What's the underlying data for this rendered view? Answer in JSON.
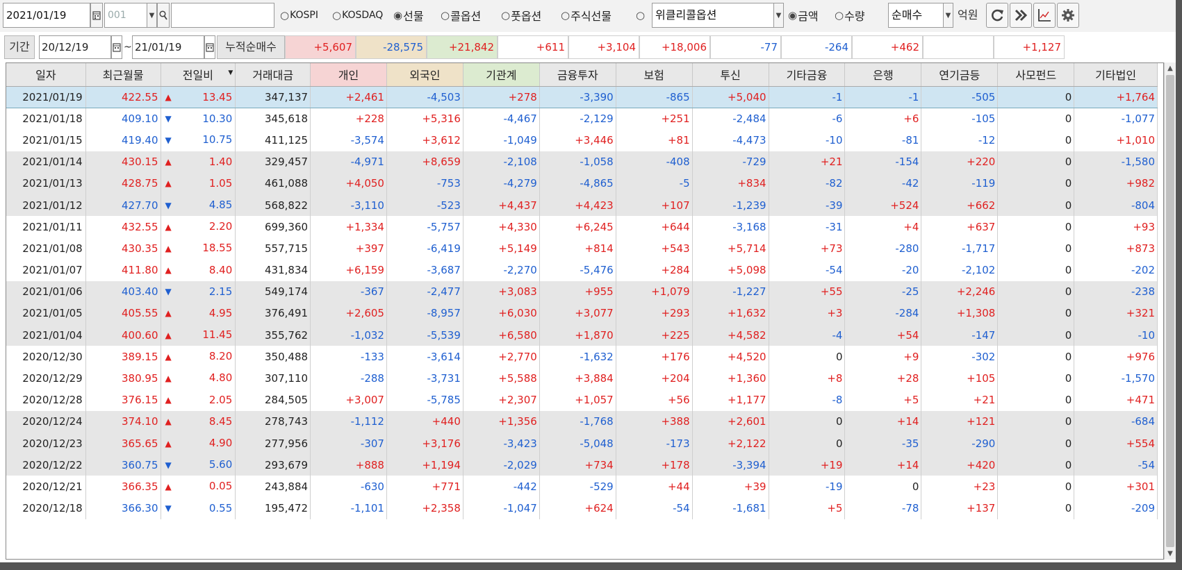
{
  "toolbar": {
    "date": "2021/01/19",
    "code": "001",
    "search_value": "",
    "radios": [
      {
        "label": "KOSPI",
        "selected": false
      },
      {
        "label": "KOSDAQ",
        "selected": false
      },
      {
        "label": "선물",
        "selected": true
      },
      {
        "label": "콜옵션",
        "selected": false
      },
      {
        "label": "풋옵션",
        "selected": false
      },
      {
        "label": "주식선물",
        "selected": false
      },
      {
        "label": "",
        "selected": false
      }
    ],
    "product_select": "위클리콜옵션",
    "unit_radios": [
      {
        "label": "금액",
        "selected": true
      },
      {
        "label": "수량",
        "selected": false
      }
    ],
    "mode_select": "순매수",
    "unit_label": "억원"
  },
  "period": {
    "label": "기간",
    "start": "20/12/19",
    "tilde": "~",
    "end": "21/01/19",
    "sum_label": "누적순매수",
    "sums": [
      "+5,607",
      "-28,575",
      "+21,842",
      "+611",
      "+3,104",
      "+18,006",
      "-77",
      "-264",
      "+462",
      "",
      "+1,127"
    ]
  },
  "table": {
    "headers": [
      "일자",
      "최근월물",
      "전일비",
      "거래대금",
      "개인",
      "외국인",
      "기관계",
      "금융투자",
      "보험",
      "투신",
      "기타금융",
      "은행",
      "연기금등",
      "사모펀드",
      "기타법인"
    ],
    "rows": [
      {
        "date": "2021/01/19",
        "price": "422.55",
        "dir": "up",
        "chg": "13.45",
        "vol": "347,137",
        "v": [
          "+2,461",
          "-4,503",
          "+278",
          "-3,390",
          "-865",
          "+5,040",
          "-1",
          "-1",
          "-505",
          "0",
          "+1,764"
        ]
      },
      {
        "date": "2021/01/18",
        "price": "409.10",
        "dir": "down",
        "chg": "10.30",
        "vol": "345,618",
        "v": [
          "+228",
          "+5,316",
          "-4,467",
          "-2,129",
          "+251",
          "-2,484",
          "-6",
          "+6",
          "-105",
          "0",
          "-1,077"
        ]
      },
      {
        "date": "2021/01/15",
        "price": "419.40",
        "dir": "down",
        "chg": "10.75",
        "vol": "411,125",
        "v": [
          "-3,574",
          "+3,612",
          "-1,049",
          "+3,446",
          "+81",
          "-4,473",
          "-10",
          "-81",
          "-12",
          "0",
          "+1,010"
        ]
      },
      {
        "date": "2021/01/14",
        "price": "430.15",
        "dir": "up",
        "chg": "1.40",
        "vol": "329,457",
        "v": [
          "-4,971",
          "+8,659",
          "-2,108",
          "-1,058",
          "-408",
          "-729",
          "+21",
          "-154",
          "+220",
          "0",
          "-1,580"
        ]
      },
      {
        "date": "2021/01/13",
        "price": "428.75",
        "dir": "up",
        "chg": "1.05",
        "vol": "461,088",
        "v": [
          "+4,050",
          "-753",
          "-4,279",
          "-4,865",
          "-5",
          "+834",
          "-82",
          "-42",
          "-119",
          "0",
          "+982"
        ]
      },
      {
        "date": "2021/01/12",
        "price": "427.70",
        "dir": "down",
        "chg": "4.85",
        "vol": "568,822",
        "v": [
          "-3,110",
          "-523",
          "+4,437",
          "+4,423",
          "+107",
          "-1,239",
          "-39",
          "+524",
          "+662",
          "0",
          "-804"
        ]
      },
      {
        "date": "2021/01/11",
        "price": "432.55",
        "dir": "up",
        "chg": "2.20",
        "vol": "699,360",
        "v": [
          "+1,334",
          "-5,757",
          "+4,330",
          "+6,245",
          "+644",
          "-3,168",
          "-31",
          "+4",
          "+637",
          "0",
          "+93"
        ]
      },
      {
        "date": "2021/01/08",
        "price": "430.35",
        "dir": "up",
        "chg": "18.55",
        "vol": "557,715",
        "v": [
          "+397",
          "-6,419",
          "+5,149",
          "+814",
          "+543",
          "+5,714",
          "+73",
          "-280",
          "-1,717",
          "0",
          "+873"
        ]
      },
      {
        "date": "2021/01/07",
        "price": "411.80",
        "dir": "up",
        "chg": "8.40",
        "vol": "431,834",
        "v": [
          "+6,159",
          "-3,687",
          "-2,270",
          "-5,476",
          "+284",
          "+5,098",
          "-54",
          "-20",
          "-2,102",
          "0",
          "-202"
        ]
      },
      {
        "date": "2021/01/06",
        "price": "403.40",
        "dir": "down",
        "chg": "2.15",
        "vol": "549,174",
        "v": [
          "-367",
          "-2,477",
          "+3,083",
          "+955",
          "+1,079",
          "-1,227",
          "+55",
          "-25",
          "+2,246",
          "0",
          "-238"
        ]
      },
      {
        "date": "2021/01/05",
        "price": "405.55",
        "dir": "up",
        "chg": "4.95",
        "vol": "376,491",
        "v": [
          "+2,605",
          "-8,957",
          "+6,030",
          "+3,077",
          "+293",
          "+1,632",
          "+3",
          "-284",
          "+1,308",
          "0",
          "+321"
        ]
      },
      {
        "date": "2021/01/04",
        "price": "400.60",
        "dir": "up",
        "chg": "11.45",
        "vol": "355,762",
        "v": [
          "-1,032",
          "-5,539",
          "+6,580",
          "+1,870",
          "+225",
          "+4,582",
          "-4",
          "+54",
          "-147",
          "0",
          "-10"
        ]
      },
      {
        "date": "2020/12/30",
        "price": "389.15",
        "dir": "up",
        "chg": "8.20",
        "vol": "350,488",
        "v": [
          "-133",
          "-3,614",
          "+2,770",
          "-1,632",
          "+176",
          "+4,520",
          "0",
          "+9",
          "-302",
          "0",
          "+976"
        ]
      },
      {
        "date": "2020/12/29",
        "price": "380.95",
        "dir": "up",
        "chg": "4.80",
        "vol": "307,110",
        "v": [
          "-288",
          "-3,731",
          "+5,588",
          "+3,884",
          "+204",
          "+1,360",
          "+8",
          "+28",
          "+105",
          "0",
          "-1,570"
        ]
      },
      {
        "date": "2020/12/28",
        "price": "376.15",
        "dir": "up",
        "chg": "2.05",
        "vol": "284,505",
        "v": [
          "+3,007",
          "-5,785",
          "+2,307",
          "+1,057",
          "+56",
          "+1,177",
          "-8",
          "+5",
          "+21",
          "0",
          "+471"
        ]
      },
      {
        "date": "2020/12/24",
        "price": "374.10",
        "dir": "up",
        "chg": "8.45",
        "vol": "278,743",
        "v": [
          "-1,112",
          "+440",
          "+1,356",
          "-1,768",
          "+388",
          "+2,601",
          "0",
          "+14",
          "+121",
          "0",
          "-684"
        ]
      },
      {
        "date": "2020/12/23",
        "price": "365.65",
        "dir": "up",
        "chg": "4.90",
        "vol": "277,956",
        "v": [
          "-307",
          "+3,176",
          "-3,423",
          "-5,048",
          "-173",
          "+2,122",
          "0",
          "-35",
          "-290",
          "0",
          "+554"
        ]
      },
      {
        "date": "2020/12/22",
        "price": "360.75",
        "dir": "down",
        "chg": "5.60",
        "vol": "293,679",
        "v": [
          "+888",
          "+1,194",
          "-2,029",
          "+734",
          "+178",
          "-3,394",
          "+19",
          "+14",
          "+420",
          "0",
          "-54"
        ]
      },
      {
        "date": "2020/12/21",
        "price": "366.35",
        "dir": "up",
        "chg": "0.05",
        "vol": "243,884",
        "v": [
          "-630",
          "+771",
          "-442",
          "-529",
          "+44",
          "+39",
          "-19",
          "0",
          "+23",
          "0",
          "+301"
        ]
      },
      {
        "date": "2020/12/18",
        "price": "366.30",
        "dir": "down",
        "chg": "0.55",
        "vol": "195,472",
        "v": [
          "-1,101",
          "+2,358",
          "-1,047",
          "+624",
          "-54",
          "-1,681",
          "+5",
          "-78",
          "+137",
          "0",
          "-209"
        ]
      }
    ]
  },
  "colors": {
    "up": "#e02020",
    "down": "#1f5fd0",
    "selected_row": "#cfe5f2"
  },
  "icons": [
    "calendar-icon",
    "search-icon",
    "refresh-icon",
    "next-icon",
    "chart-icon",
    "settings-icon"
  ]
}
